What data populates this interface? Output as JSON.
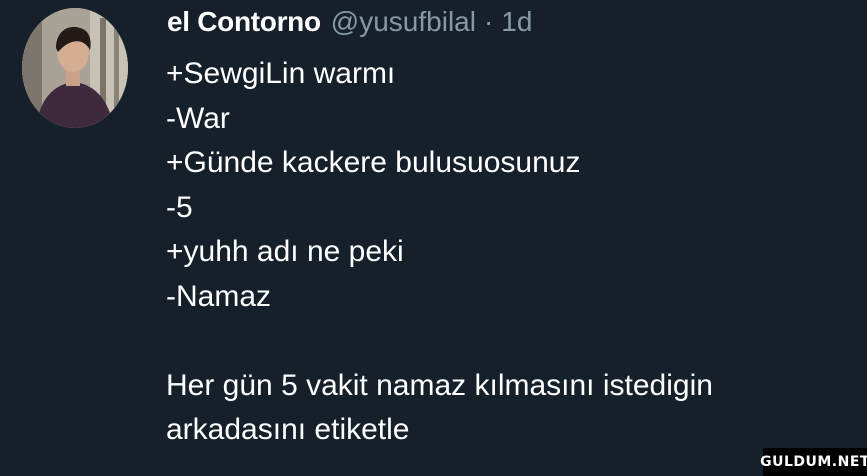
{
  "tweet": {
    "display_name": "el Contorno",
    "handle": "@yusufbilal",
    "separator": "·",
    "time": "1d",
    "lines": [
      "+SewgiLin warmı",
      "-War",
      "+Günde kackere bulusuosunuz",
      "-5",
      "+yuhh adı ne peki",
      "-Namaz",
      "",
      "Her gün 5 vakit namaz kılmasını istedigin",
      "arkadasını etiketle"
    ]
  },
  "watermark": {
    "text": "GULDUM.NET"
  },
  "colors": {
    "background": "#15202b",
    "primary_text": "#ffffff",
    "secondary_text": "#8899a6"
  }
}
